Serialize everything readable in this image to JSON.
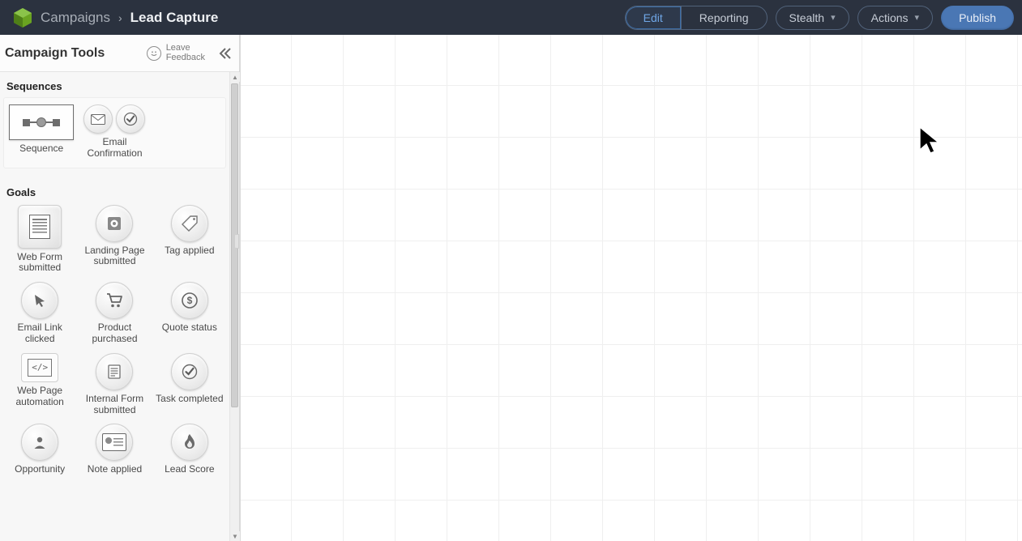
{
  "header": {
    "breadcrumb_parent": "Campaigns",
    "breadcrumb_current": "Lead Capture",
    "tabs": {
      "edit": "Edit",
      "reporting": "Reporting"
    },
    "stealth_label": "Stealth",
    "actions_label": "Actions",
    "publish_label": "Publish"
  },
  "sidebar": {
    "title": "Campaign Tools",
    "feedback_line1": "Leave",
    "feedback_line2": "Feedback",
    "sections": {
      "sequences": {
        "title": "Sequences",
        "items": [
          {
            "label": "Sequence"
          },
          {
            "label": "Email Confirmation"
          }
        ]
      },
      "goals": {
        "title": "Goals",
        "items": [
          {
            "label": "Web Form submitted"
          },
          {
            "label": "Landing Page submitted"
          },
          {
            "label": "Tag applied"
          },
          {
            "label": "Email Link clicked"
          },
          {
            "label": "Product purchased"
          },
          {
            "label": "Quote status"
          },
          {
            "label": "Web Page automation"
          },
          {
            "label": "Internal Form submitted"
          },
          {
            "label": "Task completed"
          },
          {
            "label": "Opportunity"
          },
          {
            "label": "Note applied"
          },
          {
            "label": "Lead Score"
          }
        ]
      }
    }
  }
}
